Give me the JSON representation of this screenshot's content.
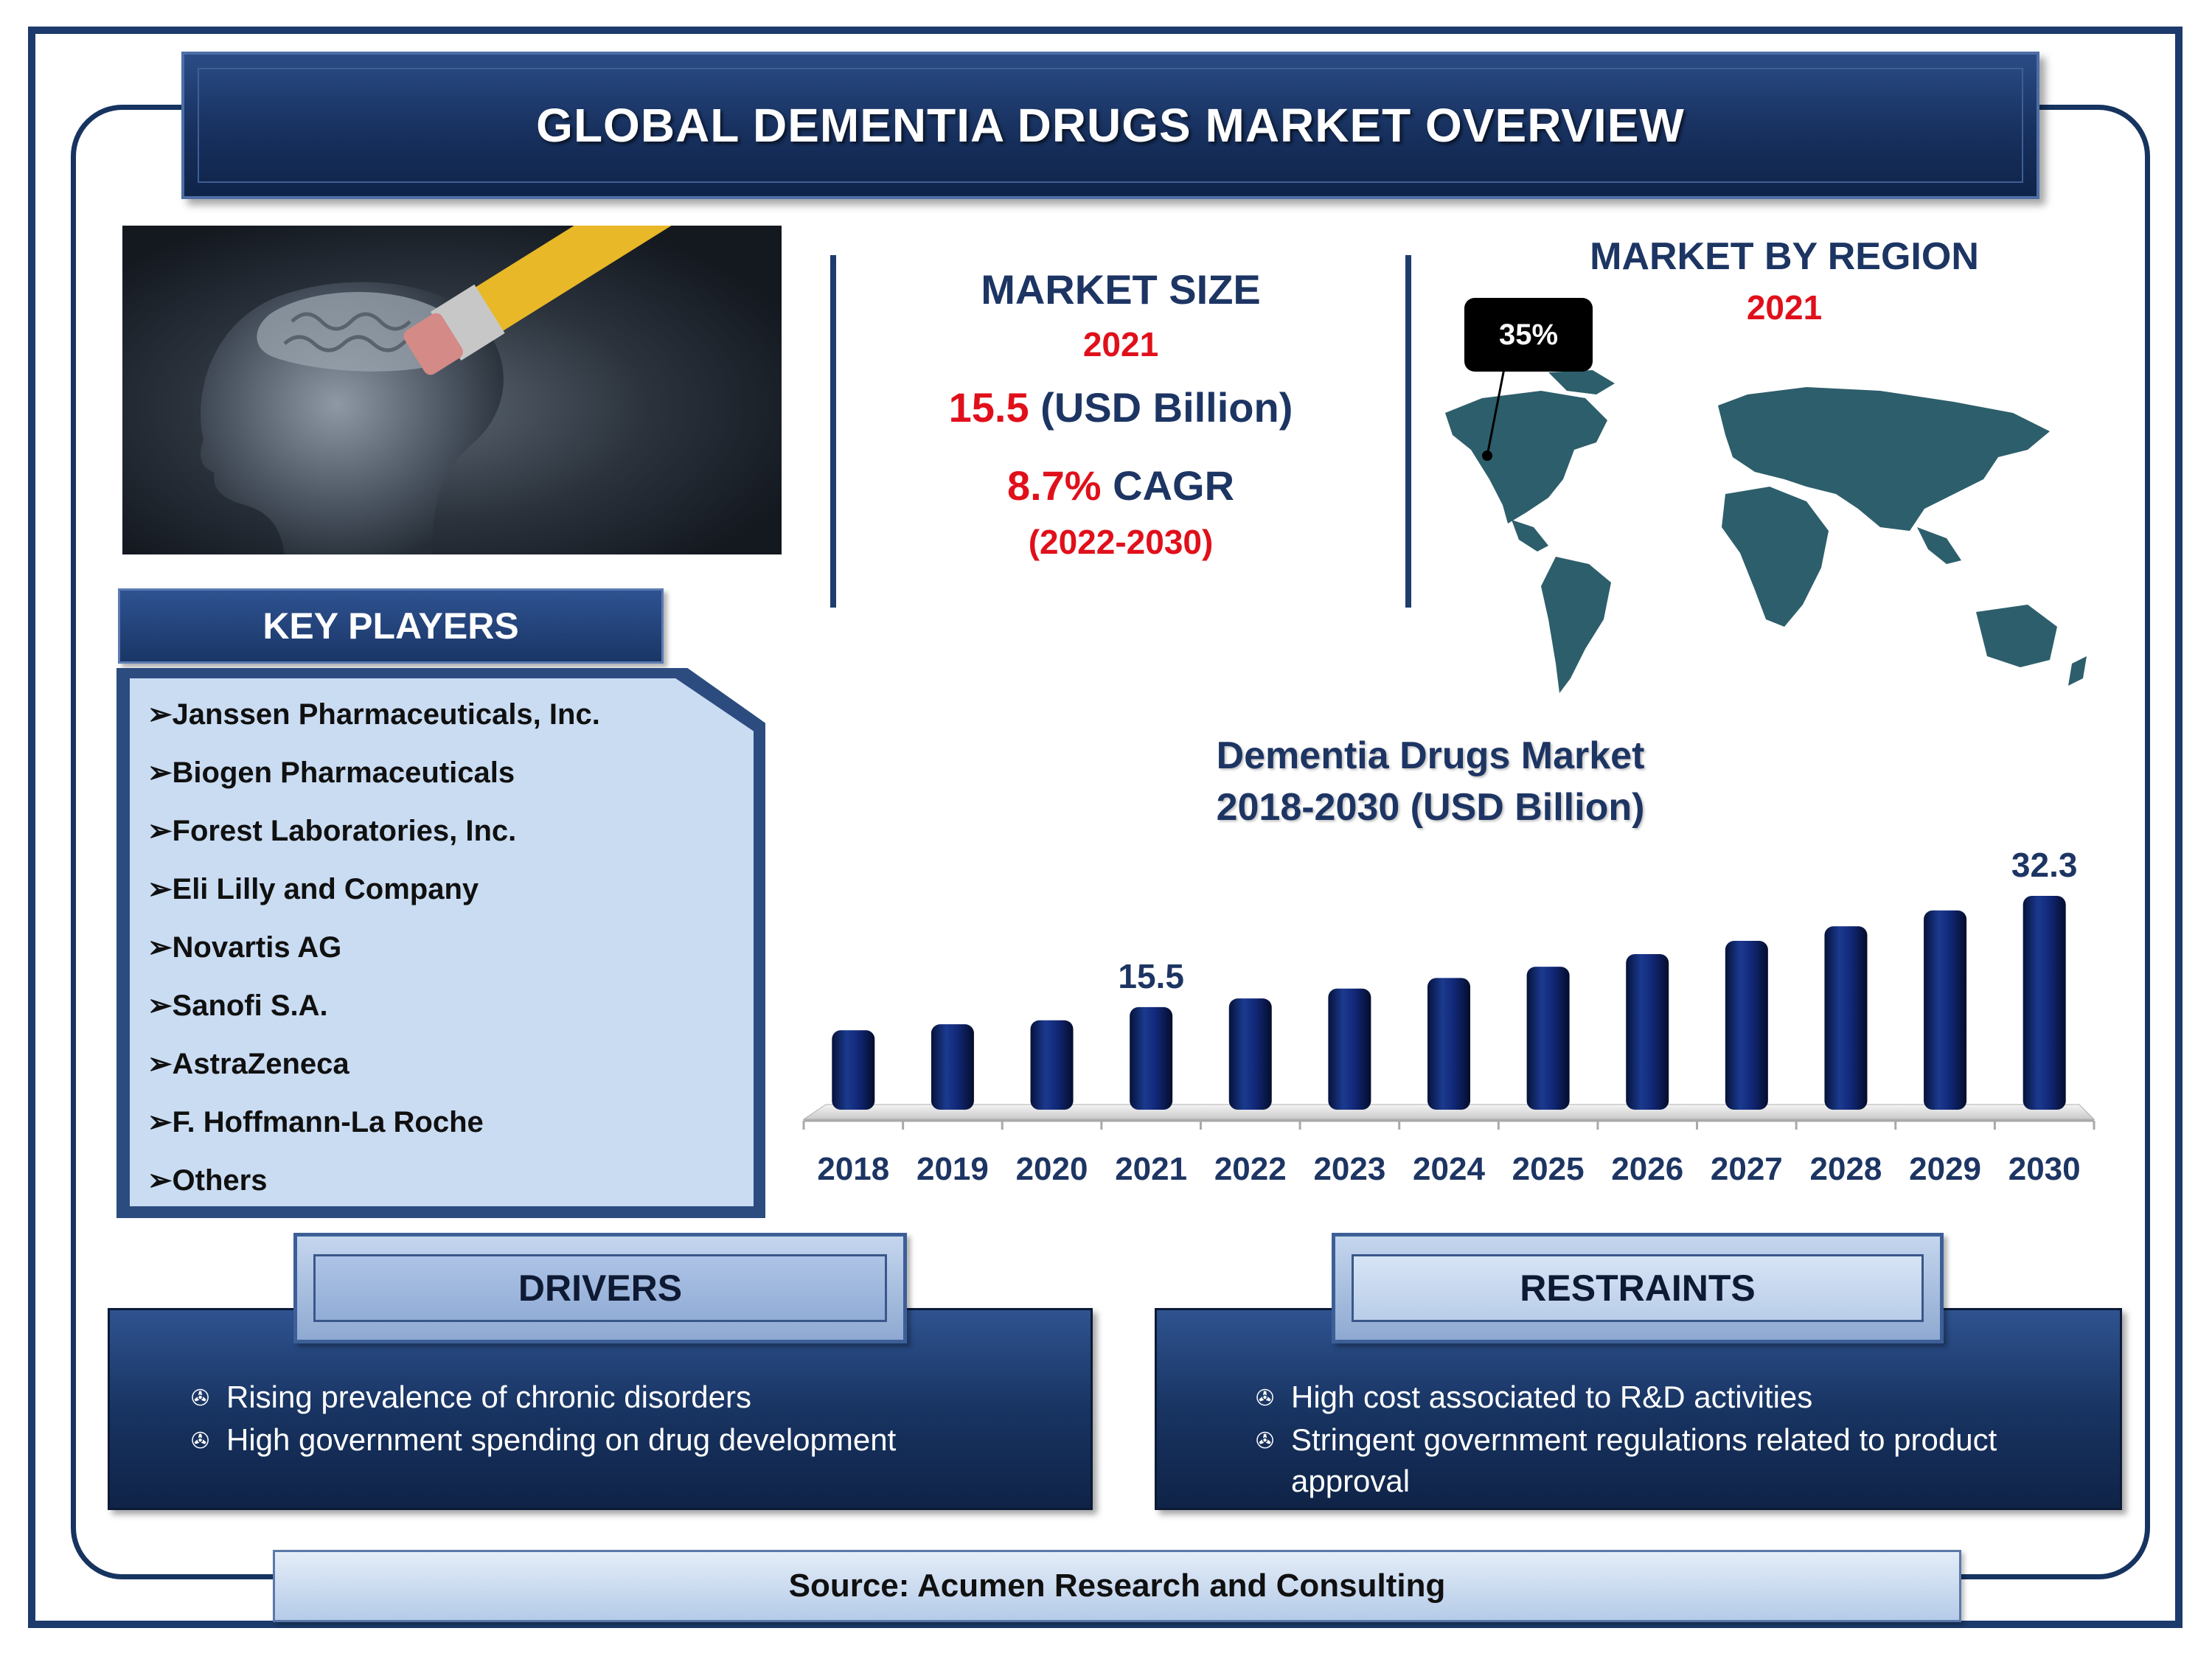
{
  "title": "GLOBAL DEMENTIA DRUGS MARKET OVERVIEW",
  "market_size": {
    "label": "MARKET SIZE",
    "year": "2021",
    "value": "15.5",
    "unit": " (USD Billion)",
    "cagr_value": "8.7%",
    "cagr_label": " CAGR",
    "cagr_period": "(2022-2030)"
  },
  "market_by_region": {
    "label": "MARKET BY REGION",
    "year": "2021",
    "callout": "35%"
  },
  "key_players": {
    "header": "KEY PLAYERS",
    "items": [
      "➢Janssen Pharmaceuticals, Inc.",
      "➢Biogen Pharmaceuticals",
      "➢Forest Laboratories, Inc.",
      "➢Eli Lilly and Company",
      "➢Novartis AG",
      "➢Sanofi S.A.",
      "➢AstraZeneca",
      "➢F. Hoffmann-La Roche",
      "➢Others"
    ]
  },
  "chart_title_line1": "Dementia Drugs Market",
  "chart_title_line2": "2018-2030  (USD Billion)",
  "chart_data": {
    "type": "bar",
    "title": "Dementia Drugs Market 2018-2030  (USD Billion)",
    "categories": [
      "2018",
      "2019",
      "2020",
      "2021",
      "2022",
      "2023",
      "2024",
      "2025",
      "2026",
      "2027",
      "2028",
      "2029",
      "2030"
    ],
    "values": [
      12.0,
      12.9,
      13.5,
      15.5,
      16.8,
      18.3,
      19.9,
      21.6,
      23.5,
      25.5,
      27.7,
      30.1,
      32.3
    ],
    "data_labels": [
      {
        "category": "2021",
        "text": "15.5"
      },
      {
        "category": "2030",
        "text": "32.3"
      }
    ],
    "ylim": [
      0,
      32.3
    ],
    "grid": false,
    "bar_color": "#0d2466"
  },
  "drivers": {
    "header": "DRIVERS",
    "items": [
      "Rising prevalence of chronic disorders",
      "High government spending on drug development"
    ]
  },
  "restraints": {
    "header": "RESTRAINTS",
    "items": [
      "High cost associated to R&D activities",
      "Stringent government regulations related to product approval"
    ]
  },
  "source": "Source: Acumen Research and Consulting",
  "colors": {
    "navy": "#1d3563",
    "accent_red": "#e0101b",
    "map_teal": "#2d5e6b"
  },
  "bullet_icon": "fax-icon"
}
